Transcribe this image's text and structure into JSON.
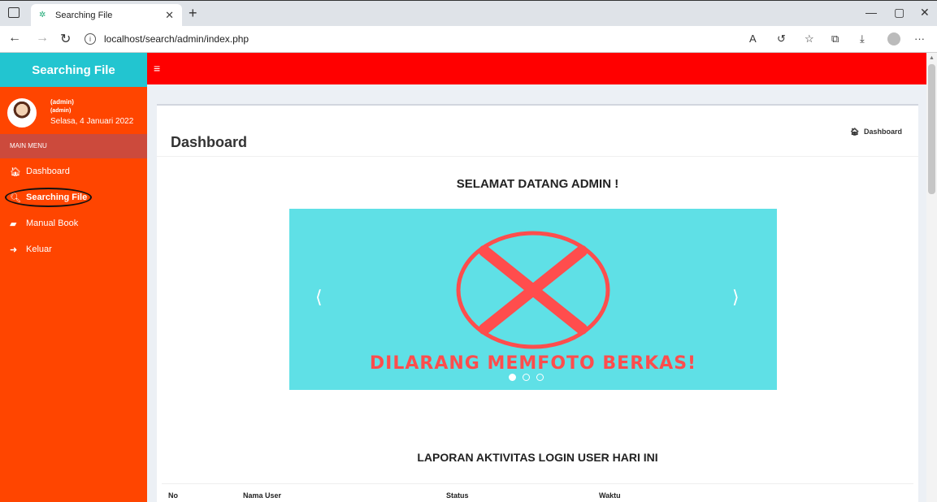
{
  "browser": {
    "tab_title": "Searching File",
    "url": "localhost/search/admin/index.php"
  },
  "sidebar": {
    "brand": "Searching File",
    "user_name": "(admin)",
    "user_role": "(admin)",
    "date": "Selasa, 4 Januari 2022",
    "section_label": "MAIN MENU",
    "items": [
      {
        "label": "Dashboard",
        "icon": "home-icon"
      },
      {
        "label": "Searching File",
        "icon": "search-icon"
      },
      {
        "label": "Manual Book",
        "icon": "book-icon"
      },
      {
        "label": "Keluar",
        "icon": "sign-out-icon"
      }
    ]
  },
  "header": {
    "page_title": "Dashboard",
    "breadcrumb": "Dashboard"
  },
  "main": {
    "welcome": "SELAMAT DATANG ADMIN !",
    "slide_text": "DILARANG MEMFOTO BERKAS!",
    "report_title": "LAPORAN AKTIVITAS LOGIN USER HARI INI",
    "table_columns": [
      "No",
      "Nama User",
      "Status",
      "Waktu"
    ]
  },
  "colors": {
    "sidebar": "#ff4500",
    "brand": "#22c5d0",
    "topbar": "#ff0000",
    "slide_bg": "#5fe0e6",
    "slide_mark": "#ff4d4d"
  }
}
